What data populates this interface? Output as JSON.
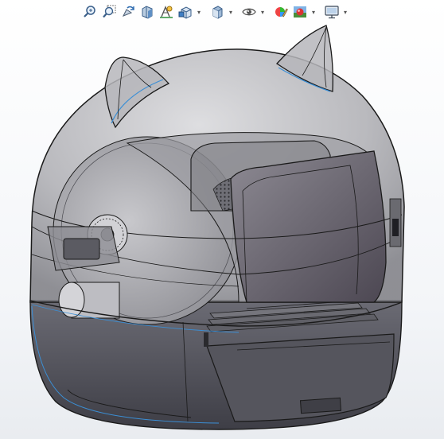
{
  "window": {
    "background_top": "#ffffff",
    "background_bottom": "#e9ecf0"
  },
  "toolbar": {
    "items": [
      {
        "icon": "zoom-to-fit-icon",
        "has_dropdown": false
      },
      {
        "icon": "zoom-to-area-icon",
        "has_dropdown": false
      },
      {
        "icon": "previous-view-icon",
        "has_dropdown": false
      },
      {
        "icon": "section-view-icon",
        "has_dropdown": false
      },
      {
        "icon": "dynamic-annotation-icon",
        "has_dropdown": false
      },
      {
        "icon": "view-orientation-icon",
        "has_dropdown": true
      },
      {
        "icon": "display-style-icon",
        "has_dropdown": true
      },
      {
        "icon": "hide-show-items-icon",
        "has_dropdown": true
      },
      {
        "icon": "edit-appearance-icon",
        "has_dropdown": false
      },
      {
        "icon": "apply-scene-icon",
        "has_dropdown": true
      },
      {
        "icon": "view-settings-icon",
        "has_dropdown": true
      }
    ]
  },
  "model": {
    "shell_color": "#9a9aa0",
    "drawer_color": "#4a4a52",
    "edge_color": "#1a1a1a",
    "highlight_edge_color": "#3b8fd6"
  }
}
